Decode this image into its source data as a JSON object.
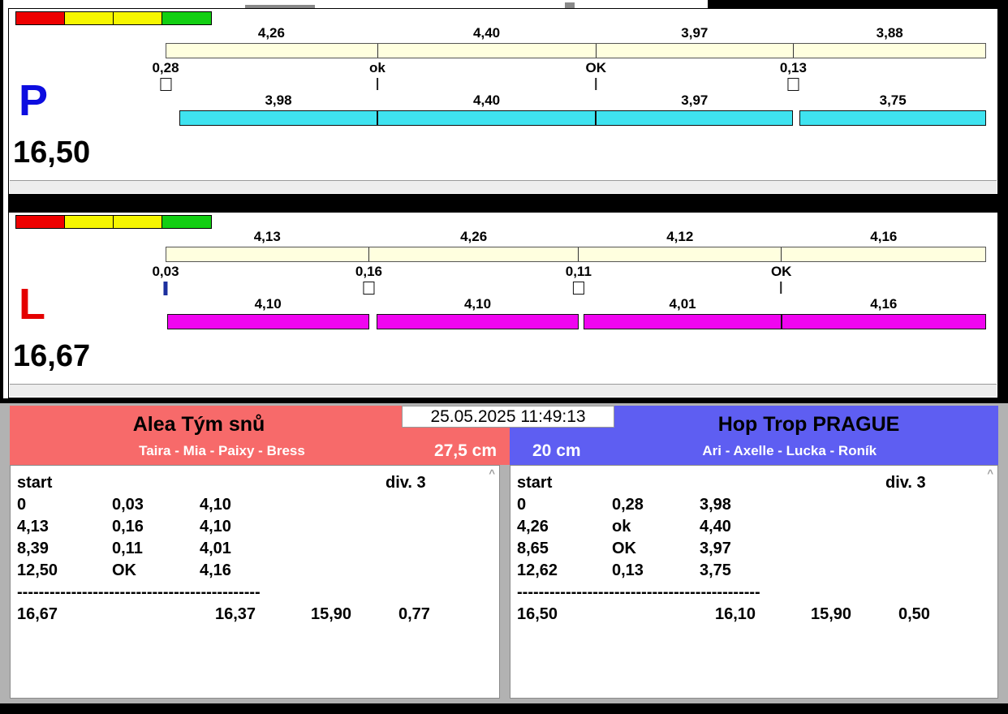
{
  "ui": {
    "traffic_lights": [
      "#ee0000",
      "#f6f600",
      "#f6f600",
      "#12cf12"
    ],
    "icons": {
      "scroll_up": "^"
    },
    "colors": {
      "cream_bar": "#ffffdf",
      "bottom_bg": "#b2b2b2"
    }
  },
  "timestamp": "25.05.2025 11:49:13",
  "lanes": [
    {
      "letter": "P",
      "letter_color": "#0d0de0",
      "total": "16,50",
      "bar_color": "#3fe3f0",
      "splits": {
        "labels": [
          "4,26",
          "4,40",
          "3,97",
          "3,88"
        ],
        "values": [
          4.26,
          4.4,
          3.97,
          3.88
        ]
      },
      "passes": [
        {
          "label": "0,28",
          "marker": "box"
        },
        {
          "label": "ok",
          "marker": "line"
        },
        {
          "label": "OK",
          "marker": "line"
        },
        {
          "label": "0,13",
          "marker": "box"
        }
      ],
      "legs": {
        "labels": [
          "3,98",
          "4,40",
          "3,97",
          "3,75"
        ],
        "values": [
          3.98,
          4.4,
          3.97,
          3.75
        ],
        "gaps": [
          0.28,
          0,
          0,
          0.13
        ]
      }
    },
    {
      "letter": "L",
      "letter_color": "#e40000",
      "total": "16,67",
      "bar_color": "#f005f0",
      "splits": {
        "labels": [
          "4,13",
          "4,26",
          "4,12",
          "4,16"
        ],
        "values": [
          4.13,
          4.26,
          4.12,
          4.16
        ]
      },
      "passes": [
        {
          "label": "0,03",
          "marker": "bluebar"
        },
        {
          "label": "0,16",
          "marker": "box"
        },
        {
          "label": "0,11",
          "marker": "box"
        },
        {
          "label": "OK",
          "marker": "line"
        }
      ],
      "legs": {
        "labels": [
          "4,10",
          "4,10",
          "4,01",
          "4,16"
        ],
        "values": [
          4.1,
          4.1,
          4.01,
          4.16
        ],
        "gaps": [
          0.03,
          0.16,
          0.11,
          0
        ]
      }
    }
  ],
  "teams": [
    {
      "name": "Alea Tým snů",
      "members": "Taira - Mia - Paixy - Bress",
      "height": "27,5 cm",
      "color": "#f76a6a",
      "table": {
        "header_start": "start",
        "header_div": "div. 3",
        "rows": [
          [
            "0",
            "0,03",
            "4,10"
          ],
          [
            "4,13",
            "0,16",
            "4,10"
          ],
          [
            "8,39",
            "0,11",
            "4,01"
          ],
          [
            "12,50",
            "OK",
            "4,16"
          ]
        ],
        "separator": "---------------------------------------------",
        "totals": [
          "16,67",
          "16,37",
          "15,90",
          "0,77"
        ]
      }
    },
    {
      "name": "Hop Trop PRAGUE",
      "members": "Ari - Axelle - Lucka - Roník",
      "height": "20 cm",
      "color": "#5e5ef2",
      "table": {
        "header_start": "start",
        "header_div": "div. 3",
        "rows": [
          [
            "0",
            "0,28",
            "3,98"
          ],
          [
            "4,26",
            "ok",
            "4,40"
          ],
          [
            "8,65",
            "OK",
            "3,97"
          ],
          [
            "12,62",
            "0,13",
            "3,75"
          ]
        ],
        "separator": "---------------------------------------------",
        "totals": [
          "16,50",
          "16,10",
          "15,90",
          "0,50"
        ]
      }
    }
  ]
}
